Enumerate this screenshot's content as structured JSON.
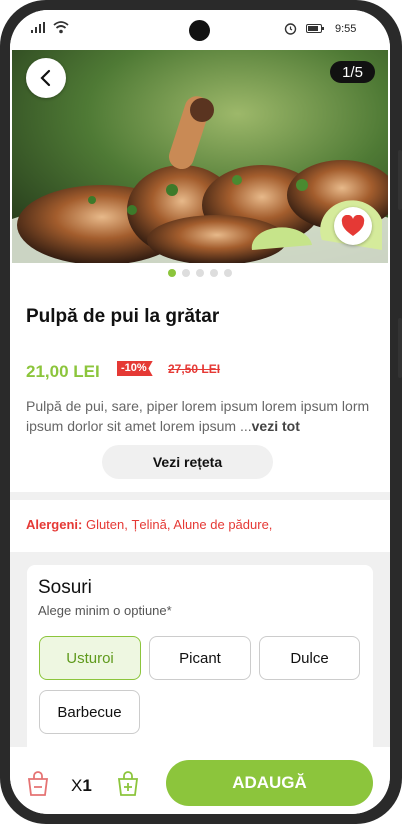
{
  "status": {
    "time": "9:55"
  },
  "gallery": {
    "counter": "1/5",
    "dots": 5,
    "active_dot": 0
  },
  "product": {
    "title": "Pulpă de pui la grătar",
    "price": "21,00 LEI",
    "discount": "-10%",
    "old_price": "27,50 LEI",
    "description": "Pulpă de pui, sare, piper lorem ipsum lorem ipsum lorm ipsum dorlor sit amet lorem ipsum ...",
    "more_link": "vezi tot",
    "recipe_button": "Vezi rețeta"
  },
  "allergens": {
    "label": "Alergeni:",
    "value": " Gluten, Țelină, Alune de pădure,"
  },
  "sauces": {
    "title": "Sosuri",
    "subtitle": "Alege minim o optiune*",
    "options": [
      "Usturoi",
      "Picant",
      "Dulce",
      "Barbecue"
    ],
    "selected": "Usturoi"
  },
  "cart": {
    "qty_prefix": "X",
    "qty": "1",
    "add_button": "ADAUGĂ"
  },
  "colors": {
    "accent": "#8cc53c",
    "danger": "#e53935"
  },
  "icons": [
    "signal-icon",
    "wifi-icon",
    "alarm-icon",
    "battery-icon",
    "back-arrow-icon",
    "heart-icon",
    "bag-minus-icon",
    "bag-plus-icon"
  ]
}
